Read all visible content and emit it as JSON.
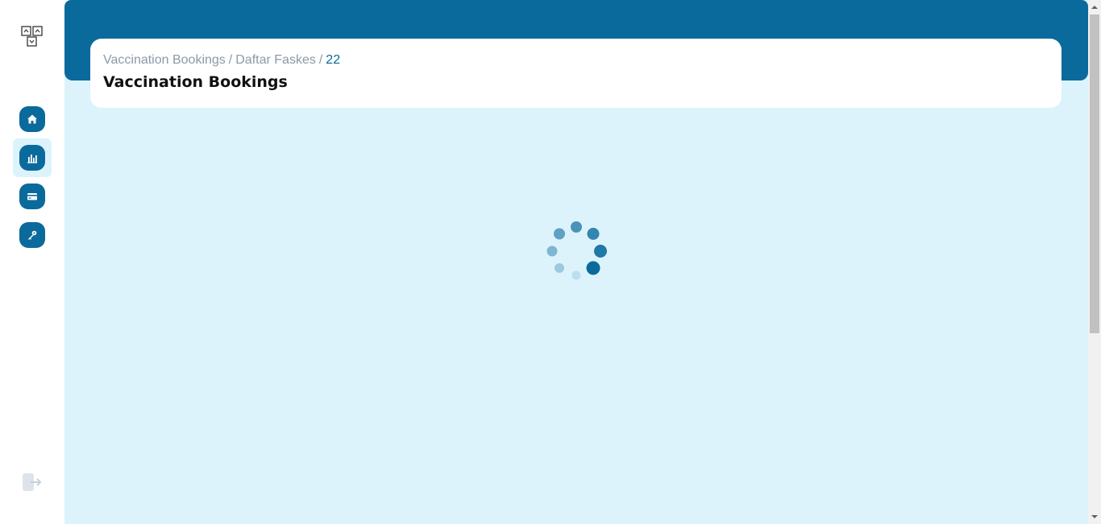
{
  "sidebar": {
    "logo": "app-logo-icon",
    "items": [
      {
        "name": "home",
        "icon": "home-icon",
        "active": false
      },
      {
        "name": "reports",
        "icon": "bar-chart-icon",
        "active": true
      },
      {
        "name": "cards",
        "icon": "credit-card-icon",
        "active": false
      },
      {
        "name": "keys",
        "icon": "key-icon",
        "active": false
      }
    ],
    "logout_icon": "logout-icon"
  },
  "breadcrumb": {
    "items": [
      "Vaccination Bookings",
      "Daftar Faskes"
    ],
    "separator": "/",
    "current": "22"
  },
  "page": {
    "title": "Vaccination Bookings",
    "loading": true
  },
  "colors": {
    "primary": "#0a6a9c",
    "background": "#dcf3fc",
    "card": "#ffffff",
    "muted_text": "#8a9aa8"
  }
}
